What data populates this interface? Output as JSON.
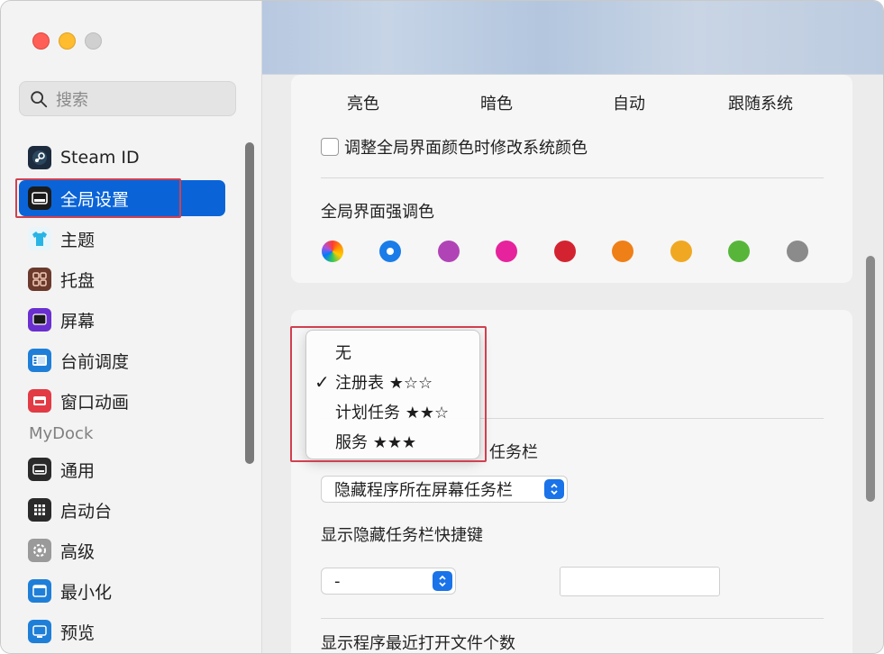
{
  "sidebar": {
    "search_placeholder": "搜索",
    "items": [
      {
        "label": "Steam ID",
        "icon": "steam-icon"
      },
      {
        "label": "全局设置",
        "icon": "window-icon",
        "active": true
      },
      {
        "label": "主题",
        "icon": "tshirt-icon"
      },
      {
        "label": "托盘",
        "icon": "tray-grid-icon"
      },
      {
        "label": "屏幕",
        "icon": "screen-icon"
      },
      {
        "label": "台前调度",
        "icon": "stage-manager-icon"
      },
      {
        "label": "窗口动画",
        "icon": "window-animation-icon"
      }
    ],
    "section_label": "MyDock",
    "items2": [
      {
        "label": "通用",
        "icon": "general-icon"
      },
      {
        "label": "启动台",
        "icon": "launchpad-icon"
      },
      {
        "label": "高级",
        "icon": "gear-icon"
      },
      {
        "label": "最小化",
        "icon": "minimize-icon"
      },
      {
        "label": "预览",
        "icon": "preview-icon"
      }
    ]
  },
  "main": {
    "theme_options": [
      "亮色",
      "暗色",
      "自动",
      "跟随系统"
    ],
    "checkbox_label": "调整全局界面颜色时修改系统颜色",
    "accent_title": "全局界面强调色",
    "accent_colors": [
      "multicolor",
      "#1a7ce8",
      "#b044b6",
      "#e6239c",
      "#d42330",
      "#ef7f17",
      "#f0a822",
      "#57b63a",
      "#8b8b8b"
    ],
    "accent_selected_index": 1,
    "taskbar_title_suffix": "任务栏",
    "hide_taskbar_select": "隐藏程序所在屏幕任务栏",
    "hotkey_title": "显示隐藏任务栏快捷键",
    "hotkey_select": "-",
    "recent_files_title": "显示程序最近打开文件个数"
  },
  "menu": {
    "items": [
      {
        "label": "无",
        "checked": false
      },
      {
        "label": "注册表 ★☆☆",
        "checked": true
      },
      {
        "label": "计划任务 ★★☆",
        "checked": false
      },
      {
        "label": "服务 ★★★",
        "checked": false
      }
    ]
  },
  "colors": {
    "accent": "#0a64d8",
    "highlight_box": "#d0404f"
  }
}
